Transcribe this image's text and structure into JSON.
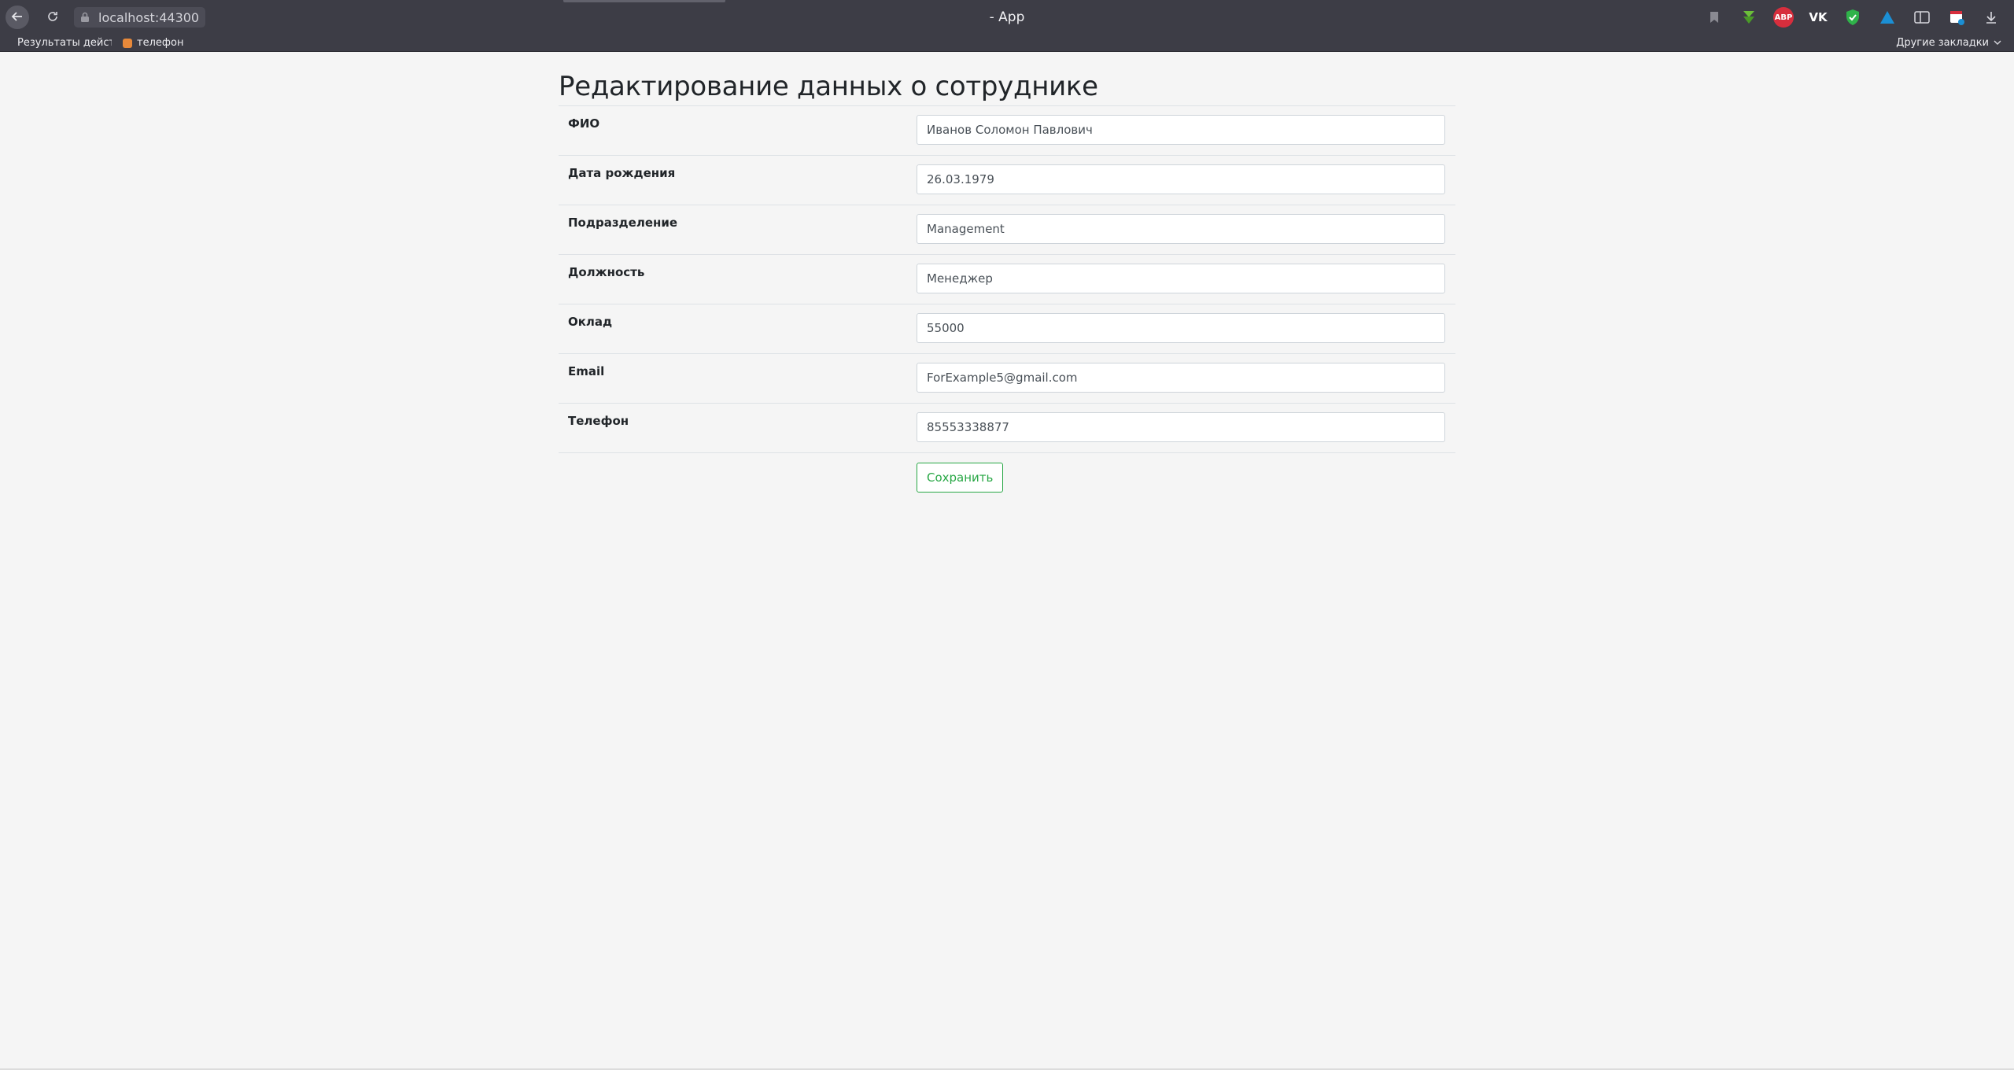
{
  "browser": {
    "url": "localhost:44300",
    "tab_title": "- App",
    "icons": {
      "back": "back-arrow-icon",
      "reload": "reload-icon",
      "lock": "lock-icon",
      "bookmark": "bookmark-icon",
      "download": "download-icon"
    },
    "extensions": {
      "abp_label": "ABP",
      "vk_label": "VK"
    },
    "bookmarks": {
      "item1": "Результаты действ",
      "item2": "телефон",
      "other": "Другие закладки"
    }
  },
  "page": {
    "title": "Редактирование данных о сотруднике",
    "fields": [
      {
        "label": "ФИО",
        "value": "Иванов Соломон Павлович"
      },
      {
        "label": "Дата рождения",
        "value": "26.03.1979"
      },
      {
        "label": "Подразделение",
        "value": "Management"
      },
      {
        "label": "Должность",
        "value": "Менеджер"
      },
      {
        "label": "Оклад",
        "value": "55000"
      },
      {
        "label": "Email",
        "value": "ForExample5@gmail.com"
      },
      {
        "label": "Телефон",
        "value": "85553338877"
      }
    ],
    "save_label": "Сохранить"
  },
  "colors": {
    "accent_success": "#28a745",
    "chrome_bg": "#3d3d46",
    "page_bg": "#f5f5f5"
  }
}
